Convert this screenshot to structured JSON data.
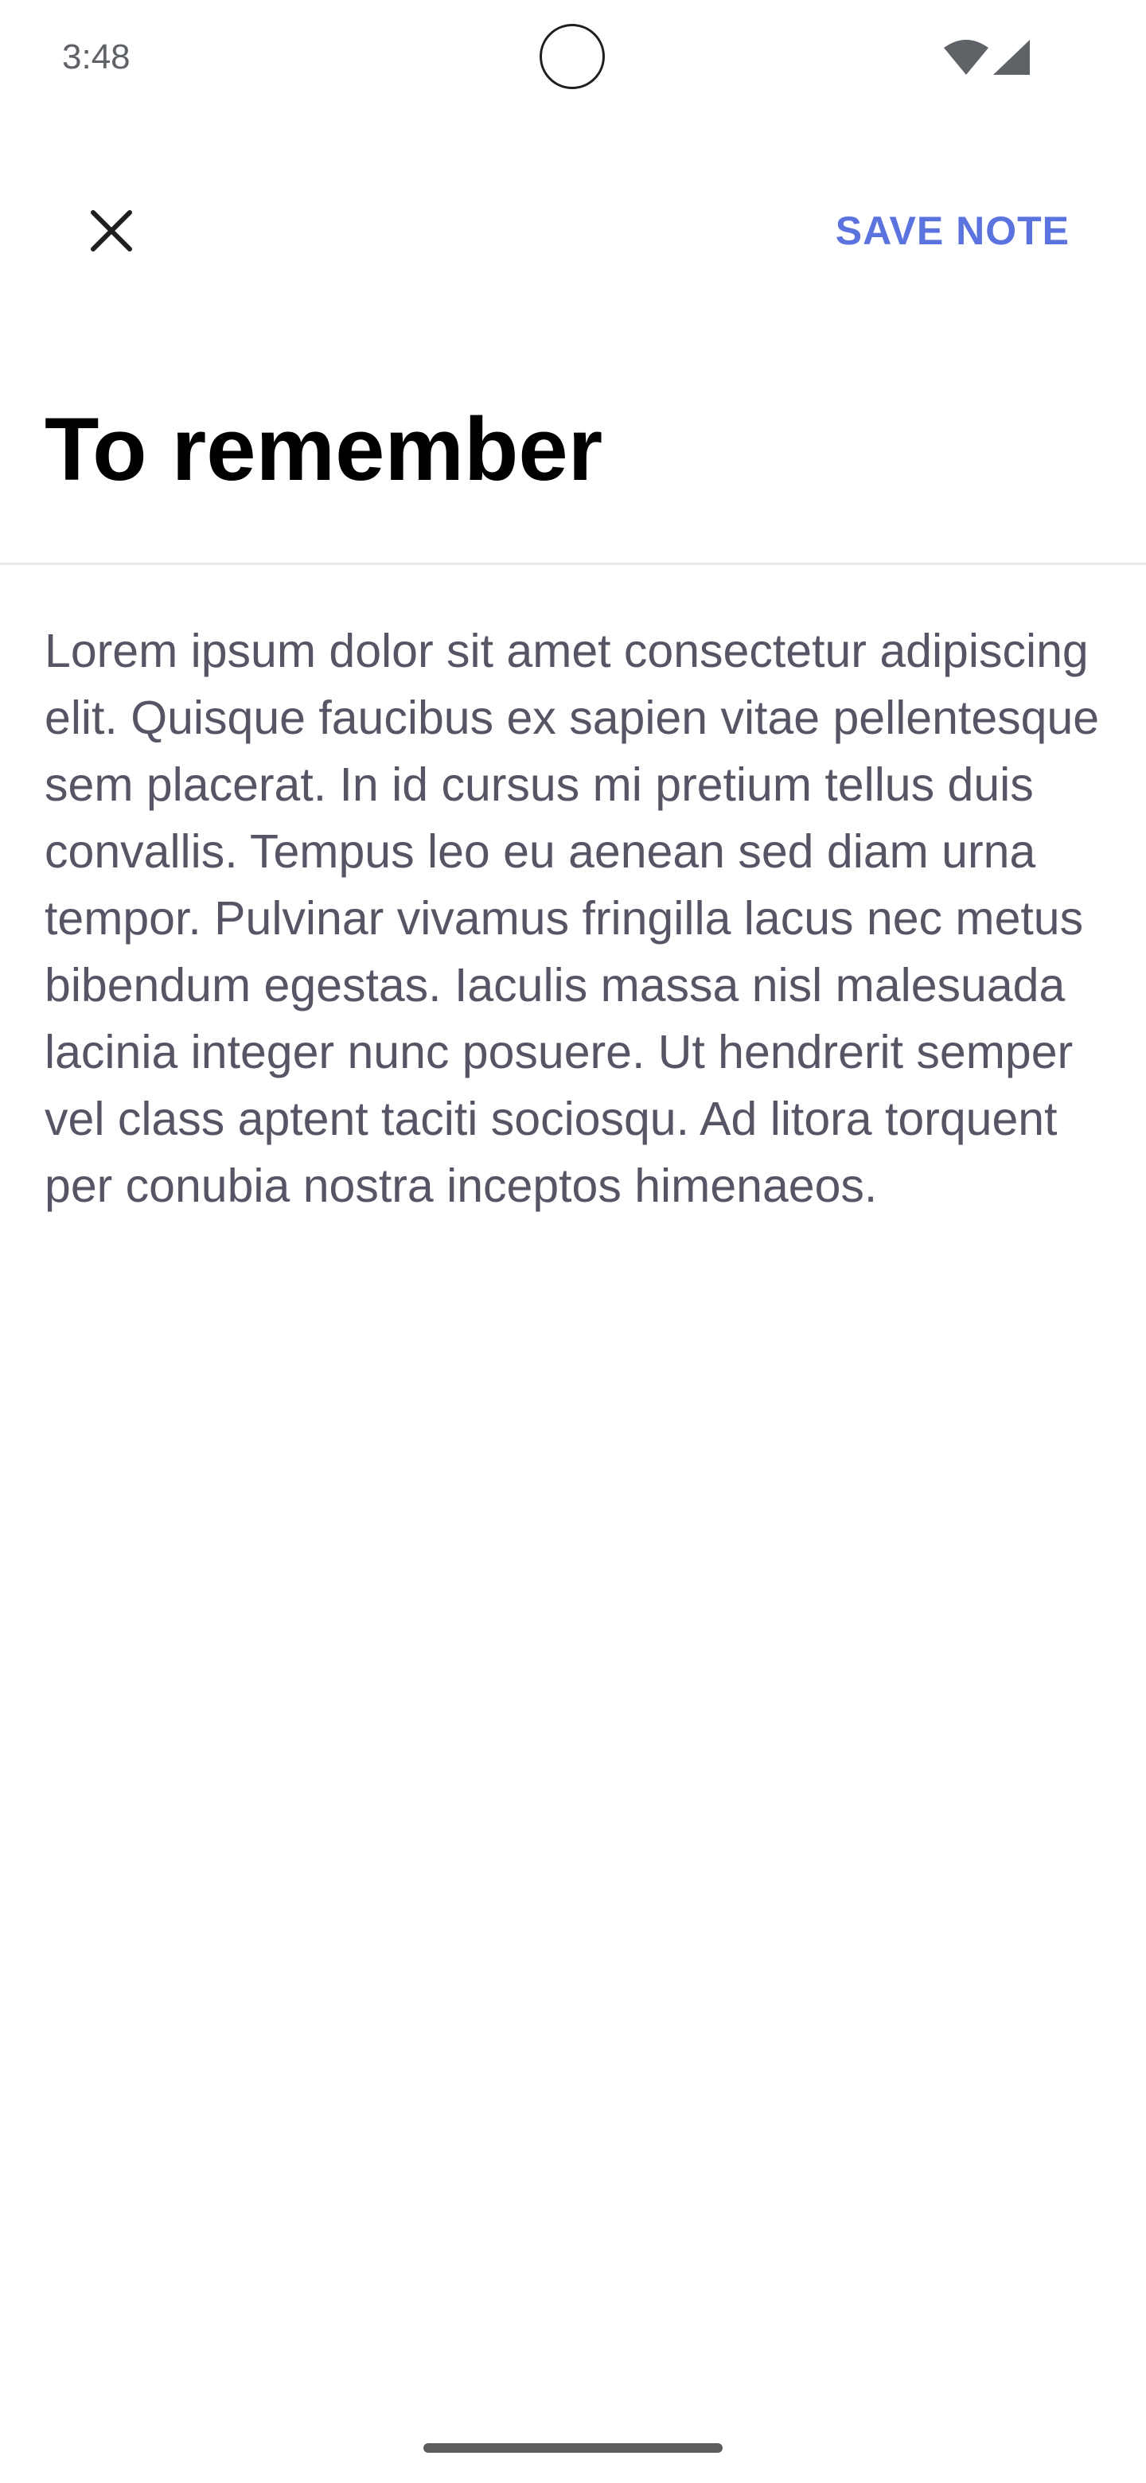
{
  "status_bar": {
    "time": "3:48",
    "icons": [
      "wifi-icon",
      "cellular-signal-icon"
    ]
  },
  "toolbar": {
    "close_icon": "close-icon",
    "save_label": "SAVE NOTE"
  },
  "note": {
    "title": "To remember",
    "body": "Lorem ipsum dolor sit amet consectetur adipiscing elit. Quisque faucibus ex sapien vitae pellentesque sem placerat. In id cursus mi pretium tellus duis convallis. Tempus leo eu aenean sed diam urna tempor. Pulvinar vivamus fringilla lacus nec metus bibendum egestas. Iaculis massa nisl malesuada lacinia integer nunc posuere. Ut hendrerit semper vel class aptent taciti sociosqu. Ad litora torquent per conubia nostra inceptos himenaeos."
  },
  "colors": {
    "accent": "#5b73de",
    "title_text": "#000000",
    "body_text": "#555566",
    "divider": "#e8e8ec"
  }
}
